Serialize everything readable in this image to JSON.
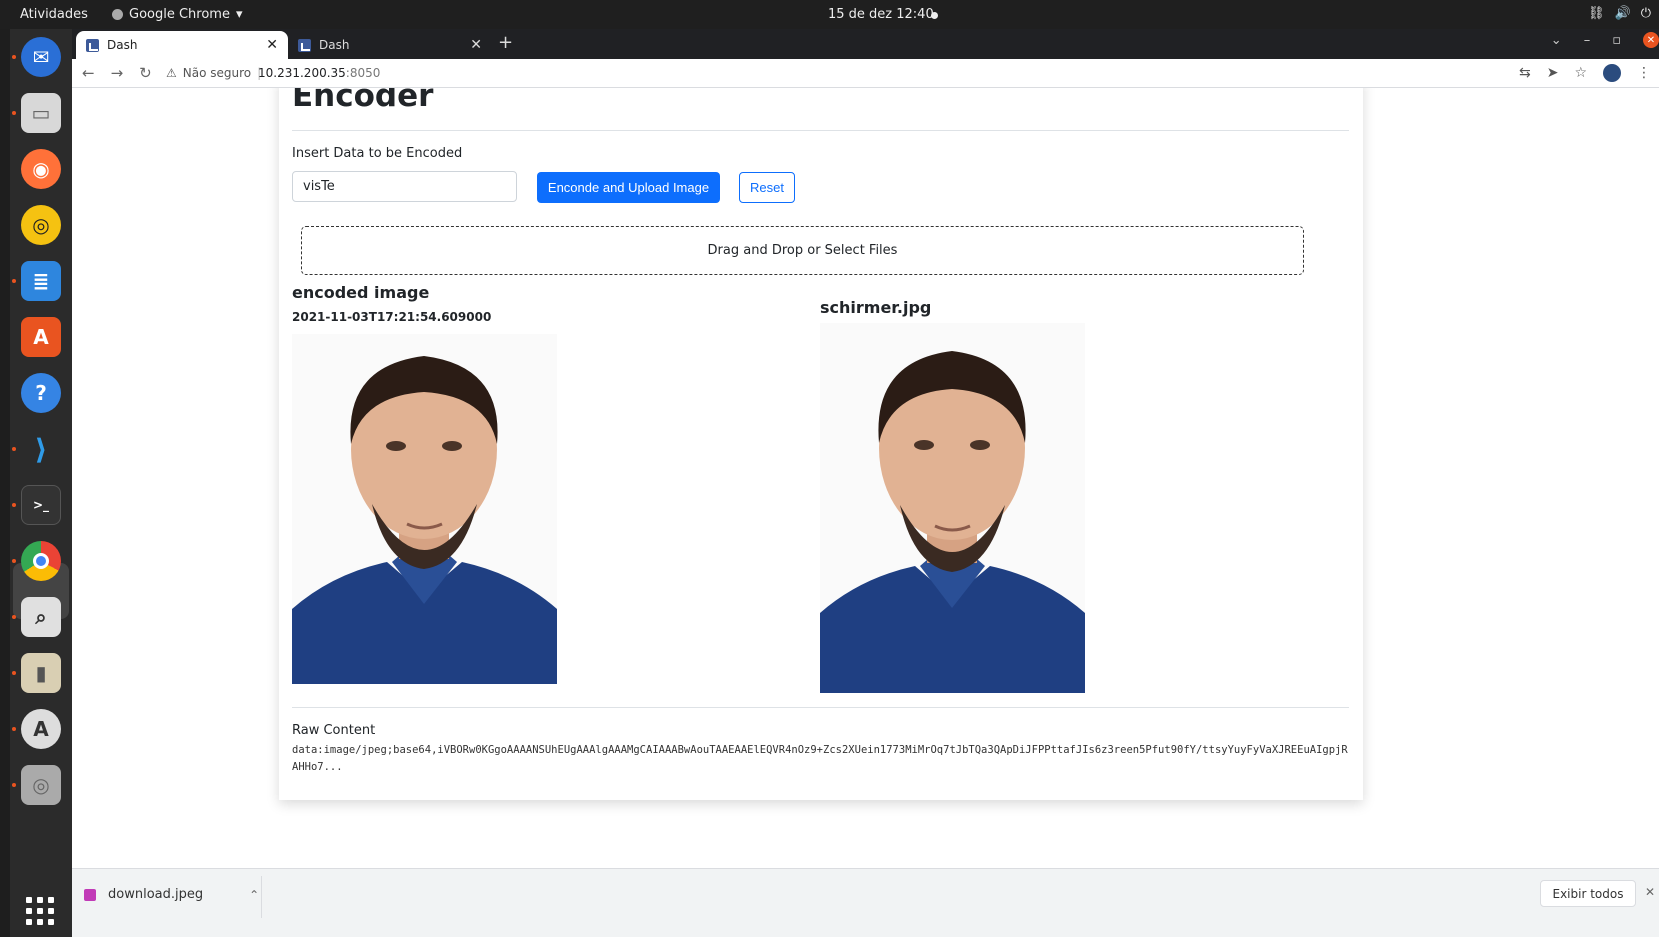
{
  "system": {
    "activities": "Atividades",
    "app_name": "Google Chrome",
    "clock": "15 de dez  12:40"
  },
  "browser": {
    "tabs": [
      {
        "title": "Dash"
      },
      {
        "title": "Dash"
      }
    ],
    "security_label": "Não seguro",
    "url_host": "10.231.200.35",
    "url_port": ":8050"
  },
  "page": {
    "title": "Encoder",
    "input_label": "Insert Data to be Encoded",
    "input_value": "visTe",
    "encode_button": "Enconde and Upload Image",
    "reset_button": "Reset",
    "dropzone_text": "Drag and Drop or Select Files",
    "encoded_heading": "encoded image",
    "encoded_timestamp": "2021-11-03T17:21:54.609000",
    "file_heading": "schirmer.jpg",
    "raw_label": "Raw Content",
    "raw_content": "data:image/jpeg;base64,iVBORw0KGgoAAAANSUhEUgAAAlgAAAMgCAIAAABwAouTAAEAAElEQVR4nOz9+Zcs2XUein1773MiMrOq7tJbTQa3QApDiJFPPttafJIs6z3reen5Pfut90fY/ttsyYuyFyVaXJREEuAIgpjRAHHo7..."
  },
  "downloads": {
    "filename": "download.jpeg",
    "show_all": "Exibir todos"
  },
  "colors": {
    "primary": "#0d6efd",
    "ubuntu_orange": "#e95420"
  }
}
